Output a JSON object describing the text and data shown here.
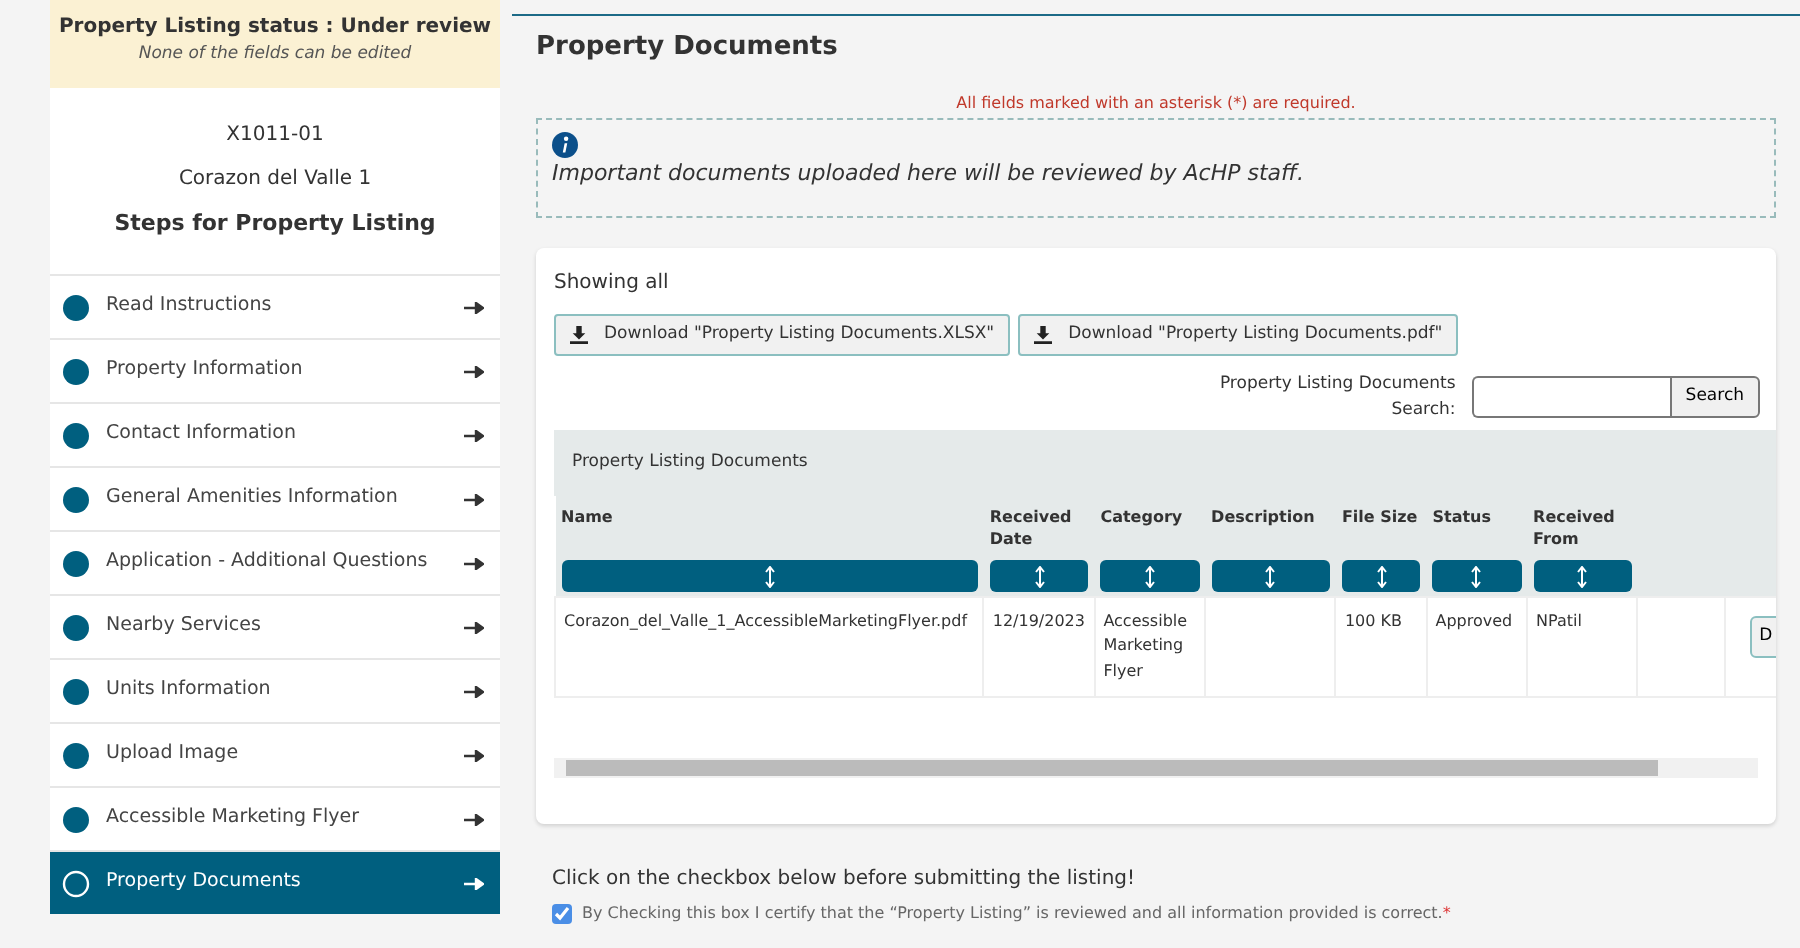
{
  "status_banner": {
    "title": "Property Listing status : Under review",
    "note": "None of the fields can be edited"
  },
  "listing": {
    "code": "X1011-01",
    "name": "Corazon del Valle 1",
    "heading": "Steps for Property Listing"
  },
  "steps": [
    {
      "label": "Read Instructions",
      "completed": true,
      "selected": false
    },
    {
      "label": "Property Information",
      "completed": true,
      "selected": false
    },
    {
      "label": "Contact Information",
      "completed": true,
      "selected": false
    },
    {
      "label": "General Amenities Information",
      "completed": true,
      "selected": false
    },
    {
      "label": "Application - Additional Questions",
      "completed": true,
      "selected": false
    },
    {
      "label": "Nearby Services",
      "completed": true,
      "selected": false
    },
    {
      "label": "Units Information",
      "completed": true,
      "selected": false
    },
    {
      "label": "Upload Image",
      "completed": true,
      "selected": false
    },
    {
      "label": "Accessible Marketing Flyer",
      "completed": true,
      "selected": false
    },
    {
      "label": "Property Documents",
      "completed": false,
      "selected": true
    }
  ],
  "page_title": "Property Documents",
  "required_note": "All fields marked with an asterisk (*) are required.",
  "info_message": "Important documents uploaded here will be reviewed by AcHP staff.",
  "showing": "Showing all",
  "downloads": [
    "Download \"Property Listing Documents.XLSX\"",
    "Download \"Property Listing Documents.pdf\""
  ],
  "search": {
    "label": "Property Listing Documents Search:",
    "button": "Search"
  },
  "table": {
    "caption": "Property Listing Documents",
    "columns": [
      "Name",
      "Received Date",
      "Category",
      "Description",
      "File Size",
      "Status",
      "Received From"
    ],
    "rows": [
      {
        "cells": [
          "Corazon_del_Valle_1_AccessibleMarketingFlyer.pdf",
          "12/19/2023",
          "Accessible Marketing Flyer",
          "",
          "100 KB",
          "Approved",
          "NPatil"
        ],
        "action": "D"
      }
    ]
  },
  "confirm": {
    "instruction": "Click on the checkbox below before submitting the listing!",
    "label": "By Checking this box I certify that the “Property Listing” is reviewed and all information provided is correct.",
    "required_mark": "*",
    "checked": true
  }
}
